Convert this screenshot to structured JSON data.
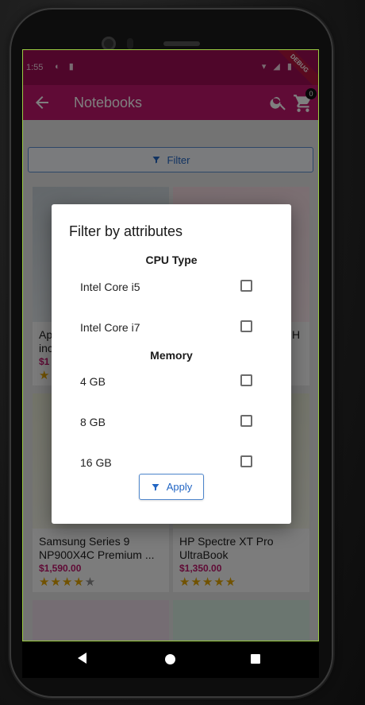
{
  "status_bar": {
    "time": "1:55",
    "left_icons": "◐ ▮",
    "right_icons": "▾ ◢ ▮",
    "debug_label": "DEBUG"
  },
  "app_bar": {
    "title": "Notebooks",
    "back_icon": "arrow-left-icon",
    "search_icon": "search-icon",
    "cart_icon": "cart-icon",
    "cart_count": "0"
  },
  "filter_bar": {
    "label": "Filter",
    "icon": "filter-icon"
  },
  "products": [
    {
      "name": "Ap\ninc",
      "price": "$1",
      "rating": 1
    },
    {
      "name": "H",
      "price": "",
      "rating": 0
    },
    {
      "name": "Samsung Series 9 NP900X4C Premium ...",
      "price": "$1,590.00",
      "rating": 4
    },
    {
      "name": "HP Spectre XT Pro UltraBook",
      "price": "$1,350.00",
      "rating": 5
    }
  ],
  "dialog": {
    "title": "Filter by attributes",
    "groups": [
      {
        "title": "CPU Type",
        "options": [
          {
            "label": "Intel Core i5",
            "checked": false
          },
          {
            "label": "Intel Core i7",
            "checked": false
          }
        ]
      },
      {
        "title": "Memory",
        "options": [
          {
            "label": "4 GB",
            "checked": false
          },
          {
            "label": "8 GB",
            "checked": false
          },
          {
            "label": "16 GB",
            "checked": false
          }
        ]
      }
    ],
    "apply_label": "Apply",
    "apply_icon": "filter-icon"
  },
  "colors": {
    "status_bar": "#9e0d55",
    "app_bar": "#c0166d",
    "price": "#c0166d",
    "accent_blue": "#2266c4",
    "star": "#e3a400"
  }
}
